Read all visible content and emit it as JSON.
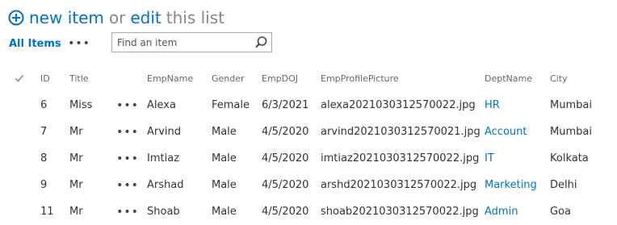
{
  "header": {
    "new_item_label": "new item",
    "or_label": "or",
    "edit_label": "edit",
    "this_list_label": "this list"
  },
  "viewbar": {
    "view_label": "All Items",
    "more_label": "•••"
  },
  "search": {
    "placeholder": "Find an item"
  },
  "table": {
    "columns": {
      "id": "ID",
      "title": "Title",
      "emp_name": "EmpName",
      "gender": "Gender",
      "emp_doj": "EmpDOJ",
      "emp_profile_picture": "EmpProfilePicture",
      "dept_name": "DeptName",
      "city": "City"
    },
    "item_menu_label": "•••",
    "rows": [
      {
        "id": "6",
        "title": "Miss",
        "emp_name": "Alexa",
        "gender": "Female",
        "emp_doj": "6/3/2021",
        "emp_profile_picture": "alexa2021030312570022.jpg",
        "dept_name": "HR",
        "city": "Mumbai"
      },
      {
        "id": "7",
        "title": "Mr",
        "emp_name": "Arvind",
        "gender": "Male",
        "emp_doj": "4/5/2020",
        "emp_profile_picture": "arvind2021030312570021.jpg",
        "dept_name": "Account",
        "city": "Mumbai"
      },
      {
        "id": "8",
        "title": "Mr",
        "emp_name": "Imtiaz",
        "gender": "Male",
        "emp_doj": "4/5/2020",
        "emp_profile_picture": "imtiaz2021030312570022.jpg",
        "dept_name": "IT",
        "city": "Kolkata"
      },
      {
        "id": "9",
        "title": "Mr",
        "emp_name": "Arshad",
        "gender": "Male",
        "emp_doj": "4/5/2020",
        "emp_profile_picture": "arshd2021030312570022.jpg",
        "dept_name": "Marketing",
        "city": "Delhi"
      },
      {
        "id": "11",
        "title": "Mr",
        "emp_name": "Shoab",
        "gender": "Male",
        "emp_doj": "4/5/2020",
        "emp_profile_picture": "shoab2021030312570022.jpg",
        "dept_name": "Admin",
        "city": "Goa"
      }
    ]
  },
  "colors": {
    "accent": "#0072c6",
    "muted": "#888888",
    "text": "#333333"
  },
  "icons": {
    "new_item": "plus-circle-icon",
    "search": "search-icon",
    "select_all": "checkmark-icon",
    "more": "ellipsis-icon"
  }
}
